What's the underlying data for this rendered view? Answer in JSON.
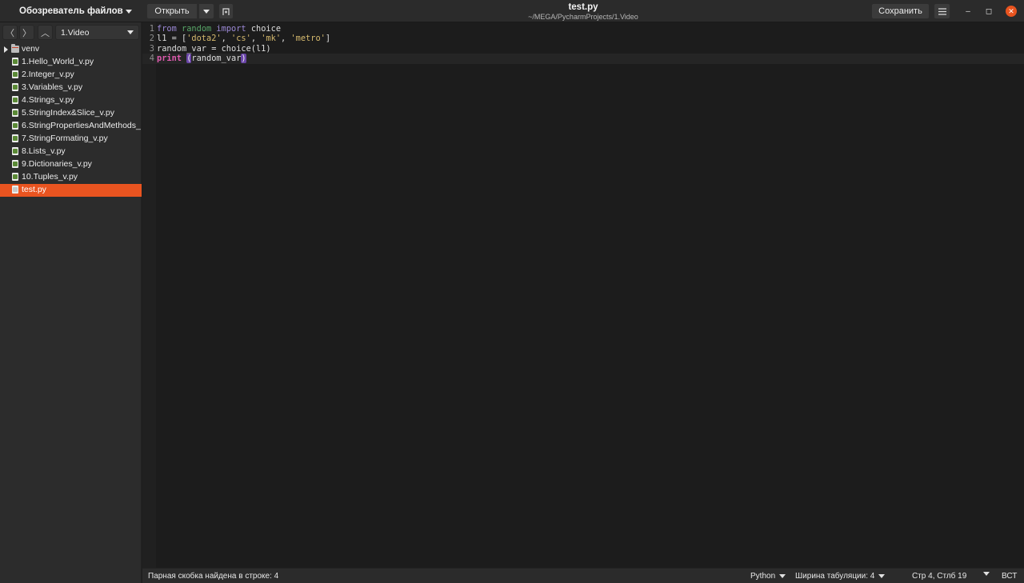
{
  "header": {
    "sidebar_title": "Обозреватель файлов",
    "open_label": "Открыть",
    "title": "test.py",
    "subtitle": "~/MEGA/PycharmProjects/1.Video",
    "save_label": "Сохранить",
    "minimize_glyph": "–",
    "maximize_glyph": "◻",
    "close_glyph": "✕"
  },
  "sidebar": {
    "nav": {
      "back_glyph": "〈",
      "forward_glyph": "〉",
      "up_glyph": "︿"
    },
    "current_folder": "1.Video",
    "items": [
      {
        "label": "venv",
        "type": "folder"
      },
      {
        "label": "1.Hello_World_v.py",
        "type": "file"
      },
      {
        "label": "2.Integer_v.py",
        "type": "file"
      },
      {
        "label": "3.Variables_v.py",
        "type": "file"
      },
      {
        "label": "4.Strings_v.py",
        "type": "file"
      },
      {
        "label": "5.StringIndex&Slice_v.py",
        "type": "file"
      },
      {
        "label": "6.StringPropertiesAndMethods_",
        "type": "file"
      },
      {
        "label": "7.StringFormating_v.py",
        "type": "file"
      },
      {
        "label": "8.Lists_v.py",
        "type": "file"
      },
      {
        "label": "9.Dictionaries_v.py",
        "type": "file"
      },
      {
        "label": "10.Tuples_v.py",
        "type": "file"
      },
      {
        "label": "test.py",
        "type": "file",
        "selected": true
      }
    ]
  },
  "editor": {
    "current_line": 4,
    "lines": [
      {
        "num": "1",
        "tokens": [
          {
            "t": "from",
            "c": "kw-a"
          },
          {
            "t": " "
          },
          {
            "t": "random",
            "c": "kw-b"
          },
          {
            "t": " "
          },
          {
            "t": "import",
            "c": "kw-a"
          },
          {
            "t": " choice"
          }
        ]
      },
      {
        "num": "2",
        "tokens": [
          {
            "t": "l1 = ["
          },
          {
            "t": "'dota2'",
            "c": "str"
          },
          {
            "t": ", "
          },
          {
            "t": "'cs'",
            "c": "str"
          },
          {
            "t": ", "
          },
          {
            "t": "'mk'",
            "c": "str"
          },
          {
            "t": ", "
          },
          {
            "t": "'metro'",
            "c": "str"
          },
          {
            "t": "]"
          }
        ]
      },
      {
        "num": "3",
        "tokens": [
          {
            "t": "random_var = choice(l1)"
          }
        ]
      },
      {
        "num": "4",
        "tokens": [
          {
            "t": "print",
            "c": "kw-c"
          },
          {
            "t": " "
          },
          {
            "t": "(",
            "c": "paren-hl"
          },
          {
            "t": "random_var"
          },
          {
            "t": ")",
            "c": "paren-hl"
          }
        ]
      }
    ]
  },
  "statusbar": {
    "message": "Парная скобка найдена в строке: 4",
    "language": "Python",
    "tab_width": "Ширина табуляции: 4",
    "cursor_position": "Стр 4, Стлб 19",
    "insert_mode": "ВСТ"
  },
  "colors": {
    "accent": "#e95420",
    "sidebar_bg": "#2c2c2c",
    "editor_bg": "#1c1c1c"
  }
}
